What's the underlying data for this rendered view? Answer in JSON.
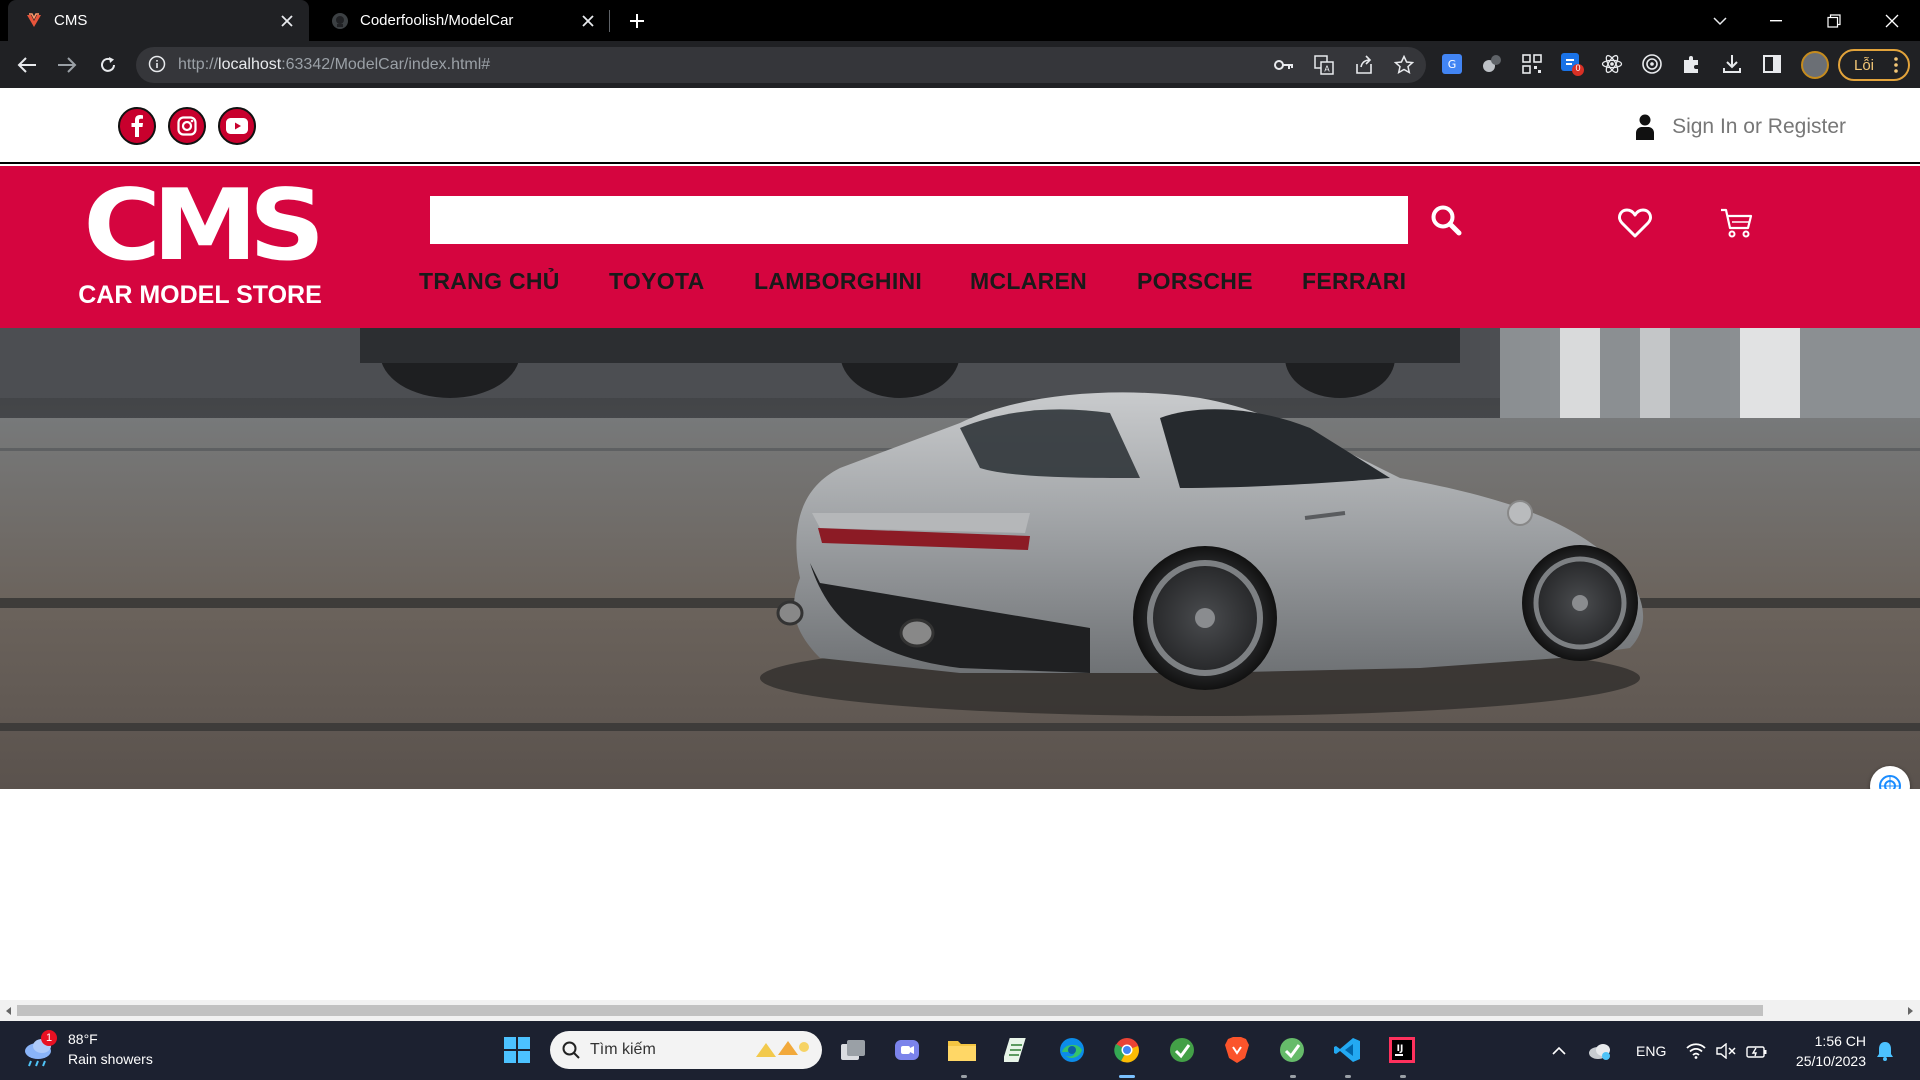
{
  "browser": {
    "tabs": [
      {
        "title": "CMS",
        "active": true
      },
      {
        "title": "Coderfoolish/ModelCar",
        "active": false
      }
    ],
    "url": {
      "prefix": "http://",
      "host": "localhost",
      "rest": ":63342/ModelCar/index.html#"
    },
    "error_button_label": "Lỗi",
    "extension_badge": "0"
  },
  "site": {
    "social": [
      "facebook-icon",
      "instagram-icon",
      "youtube-icon"
    ],
    "sign_in_label": "Sign In or Register",
    "logo": {
      "main": "CMS",
      "sub": "CAR MODEL STORE"
    },
    "search": {
      "placeholder": ""
    },
    "nav": [
      "TRANG CHỦ",
      "TOYOTA",
      "LAMBORGHINI",
      "MCLAREN",
      "PORSCHE",
      "FERRARI"
    ],
    "colors": {
      "brand_red": "#d5053f",
      "social_red": "#c8002d"
    }
  },
  "taskbar": {
    "weather": {
      "temp": "88°F",
      "desc": "Rain showers",
      "badge": "1"
    },
    "search_label": "Tìm kiếm",
    "lang": "ENG",
    "time": "1:56 CH",
    "date": "25/10/2023"
  }
}
